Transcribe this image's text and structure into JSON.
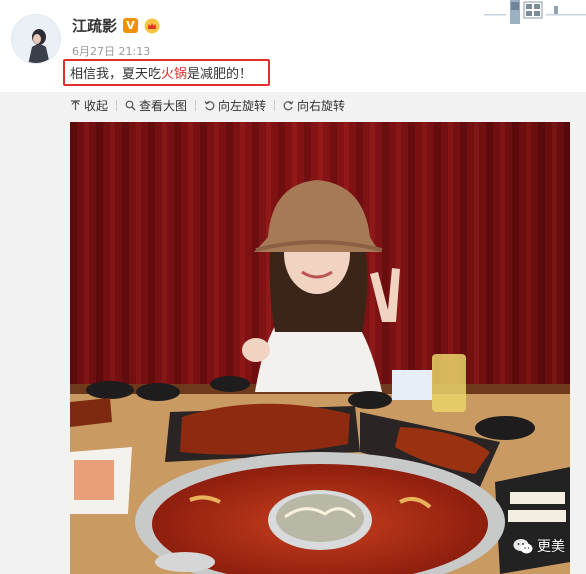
{
  "post": {
    "username": "江疏影",
    "verified_badge": "V",
    "timestamp": "6月27日 21:13",
    "text_before": "相信我，夏天吃",
    "text_highlight": "火锅",
    "text_after": "是减肥的！",
    "highlight_color": "#e0302a",
    "frame_color": "#e0302a"
  },
  "toolbar": {
    "collapse_label": "收起",
    "view_large_label": "查看大图",
    "rotate_left_label": "向左旋转",
    "rotate_right_label": "向右旋转"
  },
  "watermark": {
    "text": "更美"
  },
  "icons": [
    "up-arrow-icon",
    "magnify-icon",
    "rotate-left-icon",
    "rotate-right-icon",
    "wechat-icon",
    "crown-icon"
  ],
  "photo": {
    "subject": "woman in bucket hat making peace sign at a hotpot table"
  }
}
